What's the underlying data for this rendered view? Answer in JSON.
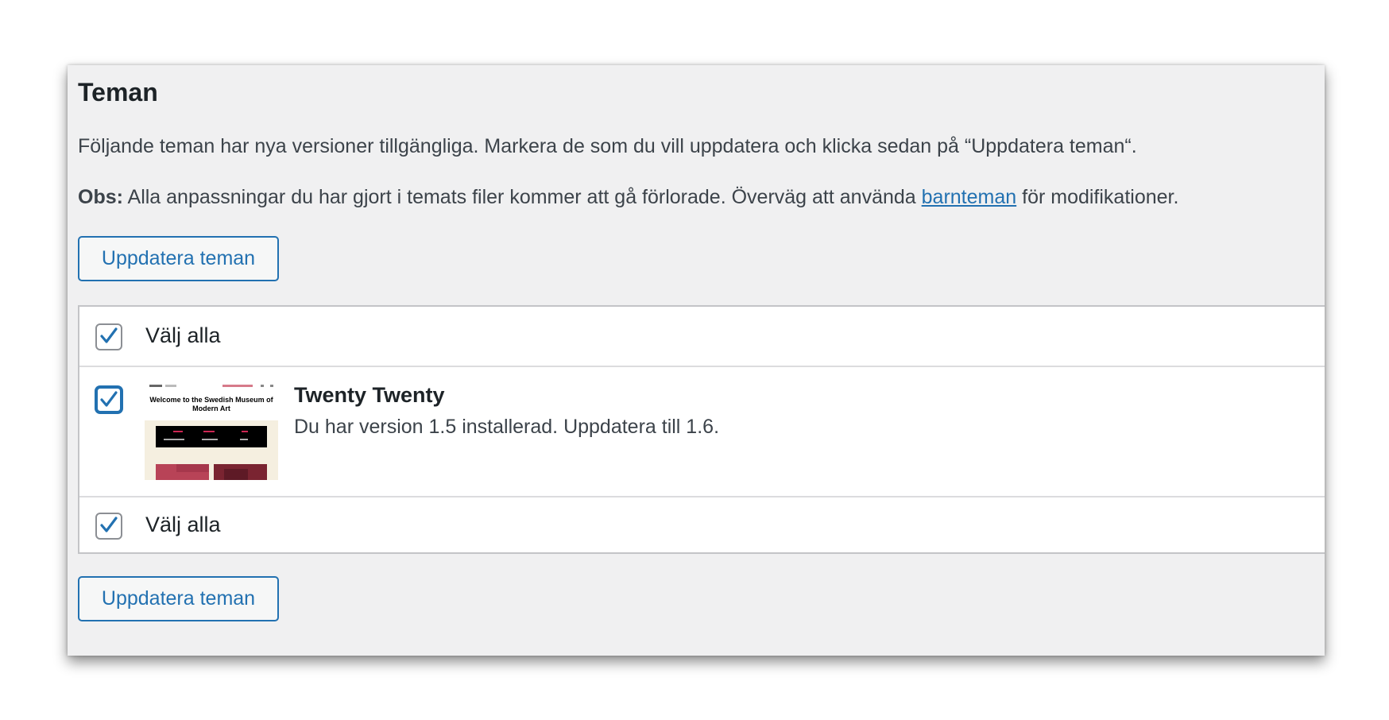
{
  "section": {
    "title": "Teman",
    "intro": "Följande teman har nya versioner tillgängliga. Markera de som du vill uppdatera och klicka sedan på “Uppdatera teman“.",
    "note_label": "Obs:",
    "note_text_before": " Alla anpassningar du har gjort i temats filer kommer att gå förlorade. Överväg att använda ",
    "note_link": "barnteman",
    "note_text_after": " för modifikationer."
  },
  "buttons": {
    "update_top": "Uppdatera teman",
    "update_bottom": "Uppdatera teman"
  },
  "table": {
    "select_all_top": {
      "label": "Välj alla",
      "checked": true
    },
    "select_all_bottom": {
      "label": "Välj alla",
      "checked": true
    },
    "themes": [
      {
        "name": "Twenty Twenty",
        "description": "Du har version 1.5 installerad. Uppdatera till 1.6.",
        "checked": true,
        "screenshot_heading": "Welcome to the Swedish Museum of Modern Art"
      }
    ]
  },
  "colors": {
    "accent": "#2271b1",
    "panel_bg": "#f0f0f1",
    "text": "#1d2327"
  },
  "icons": {
    "checkbox_check": "check-icon"
  }
}
